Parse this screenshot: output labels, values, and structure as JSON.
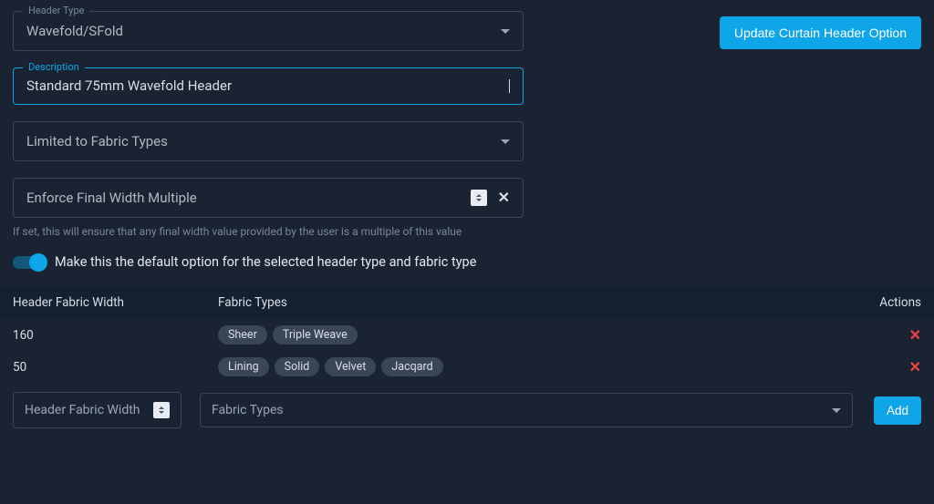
{
  "form": {
    "header_type_label": "Header Type",
    "header_type_value": "Wavefold/SFold",
    "description_label": "Description",
    "description_value": "Standard 75mm Wavefold Header",
    "fabric_types_label": "Limited to Fabric Types",
    "enforce_label": "Enforce Final Width Multiple",
    "enforce_helper": "If set, this will ensure that any final width value provided by the user is a multiple of this value",
    "toggle_label": "Make this the default option for the selected header type and fabric type",
    "update_button": "Update Curtain Header Option"
  },
  "table": {
    "col_width": "Header Fabric Width",
    "col_types": "Fabric Types",
    "col_actions": "Actions",
    "rows": [
      {
        "width": "160",
        "types": [
          "Sheer",
          "Triple Weave"
        ]
      },
      {
        "width": "50",
        "types": [
          "Lining",
          "Solid",
          "Velvet",
          "Jacqard"
        ]
      }
    ],
    "input_width_placeholder": "Header Fabric Width",
    "input_types_placeholder": "Fabric Types",
    "add_button": "Add"
  }
}
